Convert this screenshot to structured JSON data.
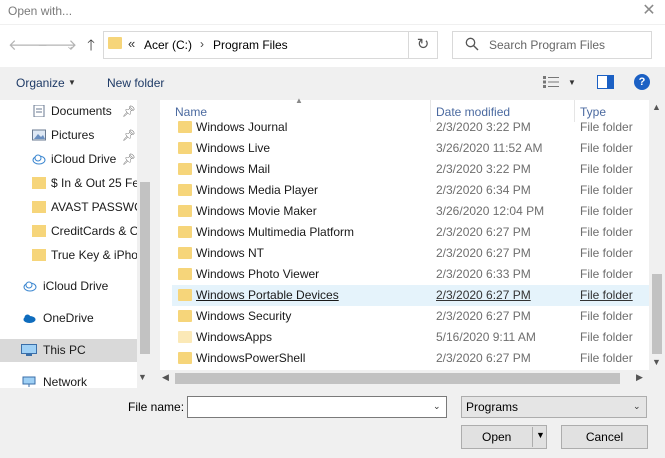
{
  "window": {
    "title": "Open with..."
  },
  "nav": {
    "back_icon": "arrow-left-icon",
    "forward_icon": "arrow-right-icon",
    "recent_icon": "chevron-down-icon",
    "up_icon": "arrow-up-icon",
    "address": {
      "chevron": "«",
      "parts": [
        "Acer (C:)",
        "Program Files"
      ],
      "separator": "›"
    },
    "search_placeholder": "Search Program Files"
  },
  "toolbar": {
    "organize_label": "Organize",
    "new_folder_label": "New folder"
  },
  "sidebar": {
    "items": [
      {
        "label": "Documents",
        "icon": "document-icon",
        "pinned": true
      },
      {
        "label": "Pictures",
        "icon": "pictures-icon",
        "pinned": true
      },
      {
        "label": "iCloud Drive",
        "icon": "cloud-icon",
        "pinned": true
      },
      {
        "label": "$ In & Out  25 Fe",
        "icon": "folder-icon",
        "pinned": false
      },
      {
        "label": "AVAST PASSWOR",
        "icon": "folder-icon",
        "pinned": false
      },
      {
        "label": "CreditCards & O",
        "icon": "folder-icon",
        "pinned": false
      },
      {
        "label": "True Key & iPho",
        "icon": "folder-icon",
        "pinned": false
      },
      {
        "label": "iCloud Drive",
        "icon": "cloud-icon",
        "pinned": false
      },
      {
        "label": "OneDrive",
        "icon": "onedrive-icon",
        "pinned": false
      },
      {
        "label": "This PC",
        "icon": "computer-icon",
        "pinned": false,
        "selected": true
      },
      {
        "label": "Network",
        "icon": "network-icon",
        "pinned": false
      }
    ]
  },
  "list": {
    "columns": {
      "name": "Name",
      "date": "Date modified",
      "type": "Type"
    },
    "rows": [
      {
        "name": "Windows Journal",
        "date": "2/3/2020 3:22 PM",
        "type": "File folder"
      },
      {
        "name": "Windows Live",
        "date": "3/26/2020 11:52 AM",
        "type": "File folder"
      },
      {
        "name": "Windows Mail",
        "date": "2/3/2020 3:22 PM",
        "type": "File folder"
      },
      {
        "name": "Windows Media Player",
        "date": "2/3/2020 6:34 PM",
        "type": "File folder"
      },
      {
        "name": "Windows Movie Maker",
        "date": "3/26/2020 12:04 PM",
        "type": "File folder"
      },
      {
        "name": "Windows Multimedia Platform",
        "date": "2/3/2020 6:27 PM",
        "type": "File folder"
      },
      {
        "name": "Windows NT",
        "date": "2/3/2020 6:27 PM",
        "type": "File folder"
      },
      {
        "name": "Windows Photo Viewer",
        "date": "2/3/2020 6:33 PM",
        "type": "File folder"
      },
      {
        "name": "Windows Portable Devices",
        "date": "2/3/2020 6:27 PM",
        "type": "File folder",
        "highlighted": true
      },
      {
        "name": "Windows Security",
        "date": "2/3/2020 6:27 PM",
        "type": "File folder"
      },
      {
        "name": "WindowsApps",
        "date": "5/16/2020 9:11 AM",
        "type": "File folder",
        "pale": true
      },
      {
        "name": "WindowsPowerShell",
        "date": "2/3/2020 6:27 PM",
        "type": "File folder"
      }
    ]
  },
  "bottom": {
    "filename_label": "File name:",
    "filename_value": "",
    "filetype_value": "Programs",
    "open_label": "Open",
    "cancel_label": "Cancel"
  },
  "colors": {
    "folder": "#f6d57a",
    "folder_pale": "#fbe9b7",
    "highlight_row": "#e5f3fb",
    "selected_nav": "#d9d9d9",
    "help_blue": "#1b60c4",
    "header_text": "#4b6aa0"
  }
}
